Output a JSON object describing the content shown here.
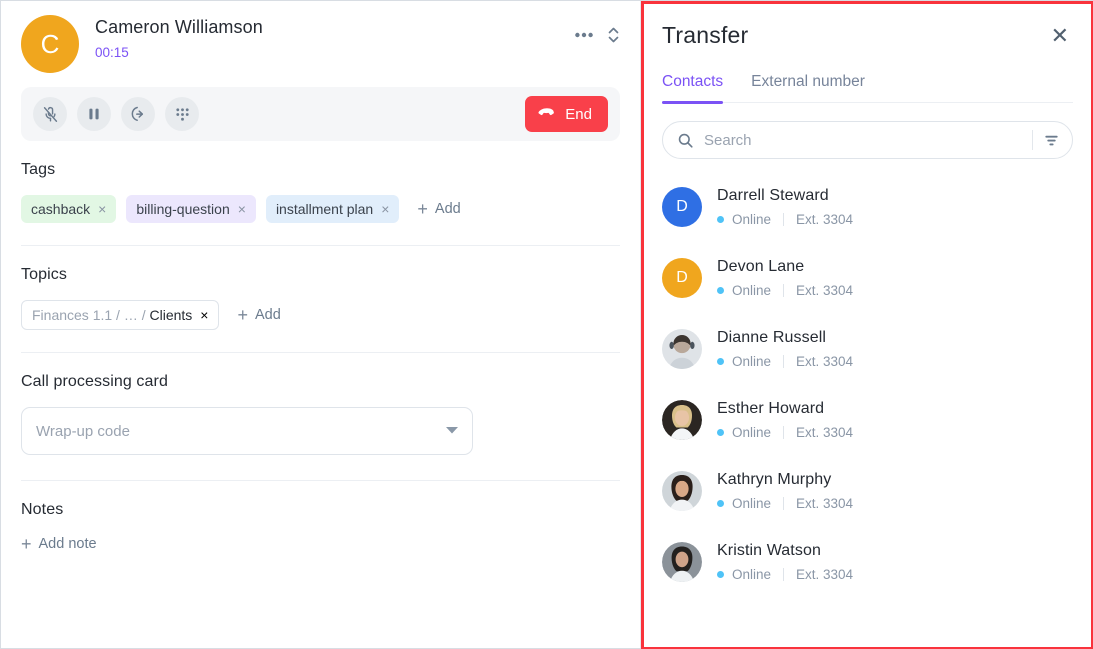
{
  "call": {
    "avatar_initial": "C",
    "avatar_color": "#f0a61e",
    "caller_name": "Cameron Williamson",
    "timer": "00:15",
    "timer_color": "#7b52f5",
    "more_icon": "ellipsis-icon",
    "expand_icon": "chevron-up-down-icon",
    "controls": [
      {
        "name": "mute-button",
        "icon": "microphone-muted-icon"
      },
      {
        "name": "hold-button",
        "icon": "pause-icon"
      },
      {
        "name": "transfer-button",
        "icon": "call-transfer-icon"
      },
      {
        "name": "keypad-button",
        "icon": "dialpad-icon"
      }
    ],
    "end_label": "End",
    "end_color": "#f9404a",
    "end_icon": "phone-hangup-icon"
  },
  "tags": {
    "title": "Tags",
    "items": [
      {
        "label": "cashback",
        "color": "#e2f7e4",
        "remove": "×"
      },
      {
        "label": "billing-question",
        "color": "#ece7fd",
        "remove": "×"
      },
      {
        "label": "installment plan",
        "color": "#e1eefb",
        "remove": "×"
      }
    ],
    "add_label": "Add",
    "add_icon": "plus-icon"
  },
  "topics": {
    "title": "Topics",
    "items": [
      {
        "path_prefix": "Finances 1.1 / … / ",
        "path_leaf": "Clients",
        "remove": "×"
      }
    ],
    "add_label": "Add",
    "add_icon": "plus-icon"
  },
  "call_card": {
    "title": "Call processing card",
    "wrapup_placeholder": "Wrap-up code",
    "caret_icon": "chevron-down-icon"
  },
  "notes": {
    "title": "Notes",
    "add_label": "Add note",
    "add_icon": "plus-icon"
  },
  "transfer": {
    "title": "Transfer",
    "close_icon": "close-icon",
    "close_glyph": "✕",
    "highlight_color": "#f9333c",
    "accent_color": "#7b52f5",
    "tabs": [
      {
        "label": "Contacts",
        "active": true
      },
      {
        "label": "External number",
        "active": false
      }
    ],
    "search": {
      "placeholder": "Search",
      "value": "",
      "search_icon": "search-icon",
      "filter_icon": "filter-icon"
    },
    "contacts": [
      {
        "name": "Darrell Steward",
        "status": "Online",
        "ext": "Ext. 3304",
        "avatar_type": "initial",
        "initial": "D",
        "avatar_color": "#2f6fe4"
      },
      {
        "name": "Devon Lane",
        "status": "Online",
        "ext": "Ext. 3304",
        "avatar_type": "initial",
        "initial": "D",
        "avatar_color": "#f0a61e"
      },
      {
        "name": "Dianne Russell",
        "status": "Online",
        "ext": "Ext. 3304",
        "avatar_type": "photo",
        "photo_tone": "#b9a89a",
        "photo_hair": "#3c3530",
        "photo_bg": "#dfe3e7"
      },
      {
        "name": "Esther Howard",
        "status": "Online",
        "ext": "Ext. 3304",
        "avatar_type": "photo",
        "photo_tone": "#e8c4a6",
        "photo_hair": "#d9c08a",
        "photo_bg": "#2b2622"
      },
      {
        "name": "Kathryn Murphy",
        "status": "Online",
        "ext": "Ext. 3304",
        "avatar_type": "photo",
        "photo_tone": "#d9a887",
        "photo_hair": "#2a1f1a",
        "photo_bg": "#cfd5d9"
      },
      {
        "name": "Kristin Watson",
        "status": "Online",
        "ext": "Ext. 3304",
        "avatar_type": "photo",
        "photo_tone": "#cfa389",
        "photo_hair": "#23201e",
        "photo_bg": "#8b9299"
      }
    ],
    "status_dot_color": "#4fc3f7",
    "meta_separator": "|"
  }
}
